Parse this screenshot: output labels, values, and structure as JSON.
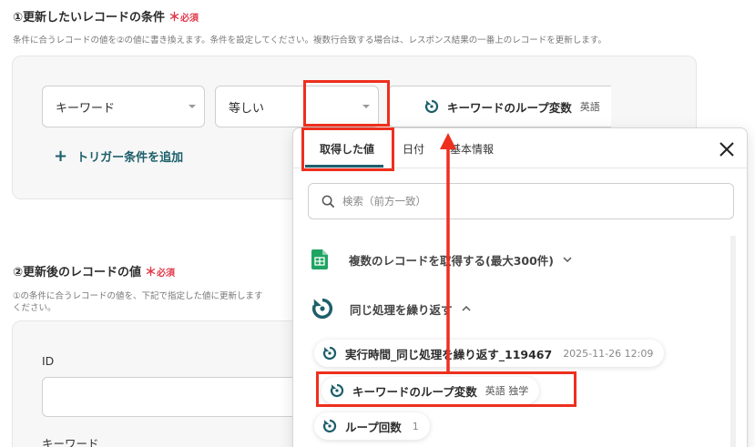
{
  "section1": {
    "title": "①更新したいレコードの条件",
    "required": "必須",
    "description": "条件に合うレコードの値を②の値に書き換えます。条件を設定してください。複数行合致する場合は、レスポンス結果の一番上のレコードを更新します。"
  },
  "condition": {
    "field": "キーワード",
    "operator": "等しい",
    "value_chip": {
      "label": "キーワードのループ変数",
      "sub": "英語"
    },
    "add_button": "トリガー条件を追加"
  },
  "section2": {
    "title": "②更新後のレコードの値",
    "required": "必須",
    "description_line1": "①の条件に合うレコードの値を、下記で指定した値に更新します",
    "description_line2": "ください。"
  },
  "fields": [
    {
      "label": "ID"
    },
    {
      "label": "キーワード"
    }
  ],
  "popup": {
    "tabs": [
      "取得した値",
      "日付",
      "基本情報"
    ],
    "active_tab": 0,
    "search_placeholder": "検索（前方一致）",
    "groups": [
      {
        "label": "複数のレコードを取得する(最大300件)",
        "icon": "sheets-icon",
        "expanded": false
      },
      {
        "label": "同じ処理を繰り返す",
        "icon": "loop-icon",
        "expanded": true
      }
    ],
    "items": [
      {
        "label": "実行時間_同じ処理を繰り返す_119467",
        "value": "2025-11-26 12:09"
      },
      {
        "label": "キーワードのループ変数",
        "value": "英語 独学"
      },
      {
        "label": "ループ回数",
        "value": "1"
      }
    ]
  },
  "colors": {
    "accent": "#1d5f6b",
    "required": "#e0394a",
    "highlight": "#ee2f1e",
    "sheets_green": "#1fa463"
  }
}
